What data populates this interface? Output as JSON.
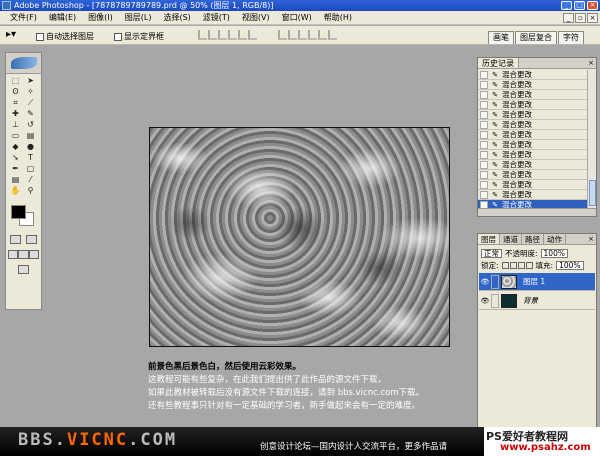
{
  "window": {
    "title": "Adobe Photoshop - [7878789789789.prd @ 50% (图层 1, RGB/8)]"
  },
  "menu": [
    "文件(F)",
    "编辑(E)",
    "图像(I)",
    "图层(L)",
    "选择(S)",
    "滤镜(T)",
    "视图(V)",
    "窗口(W)",
    "帮助(H)"
  ],
  "options": {
    "auto_select_layer": "自动选择图层",
    "show_bounding_box": "显示定界框",
    "palette_well_tabs": [
      "画笔",
      "图层复合",
      "字符"
    ]
  },
  "history": {
    "tab": "历史记录",
    "items": [
      "混合更改",
      "混合更改",
      "混合更改",
      "混合更改",
      "混合更改",
      "混合更改",
      "混合更改",
      "混合更改",
      "混合更改",
      "混合更改",
      "混合更改",
      "混合更改",
      "混合更改",
      "混合更改"
    ],
    "selected_index": 13
  },
  "layers": {
    "tabs": [
      "图层",
      "通道",
      "路径",
      "动作"
    ],
    "blend_mode": "正常",
    "opacity_label": "不透明度:",
    "opacity_value": "100%",
    "lock_label": "锁定:",
    "fill_label": "填充:",
    "fill_value": "100%",
    "list": [
      {
        "name": "图层 1",
        "selected": true
      },
      {
        "name": "背景",
        "selected": false
      }
    ]
  },
  "tutorial": {
    "line1": "前景色黑后景色白，然后使用云彩效果。",
    "line2": "这教程可能有些复杂，在此我们提出供了此作品的源文件下载，",
    "line3": "如果此教材被转载后没有源文件下载的连接，请到 bbs.vicnc.com下载。",
    "line4": "还有些教程事只针对有一定基础的学习者，新手做起来会有一定的难度。"
  },
  "watermark": {
    "logo_prefix": "BBS.",
    "logo_accent": "VICNC",
    "logo_suffix": ".COM",
    "slogan": "创意设计论坛—国内设计人交流平台，更多作品请",
    "site_name": "PS爱好者教程网",
    "site_url": "www.psahz.com"
  }
}
